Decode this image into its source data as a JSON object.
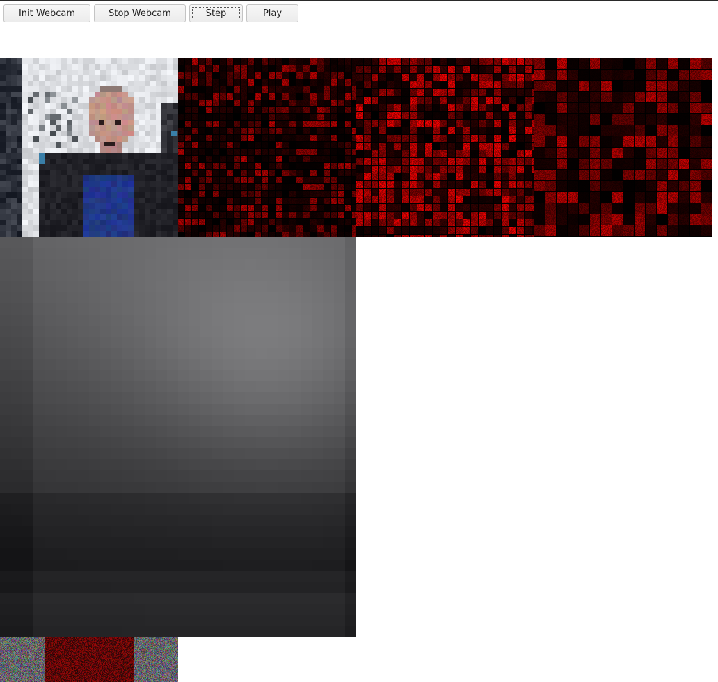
{
  "toolbar": {
    "init_label": "Init Webcam",
    "stop_label": "Stop Webcam",
    "step_label": "Step",
    "play_label": "Play",
    "focused_button": "Step"
  },
  "colors": {
    "feature_map_tint": "#ff0000",
    "page_background": "#ffffff",
    "reconstruction_tone": "#7a7a7a"
  }
}
